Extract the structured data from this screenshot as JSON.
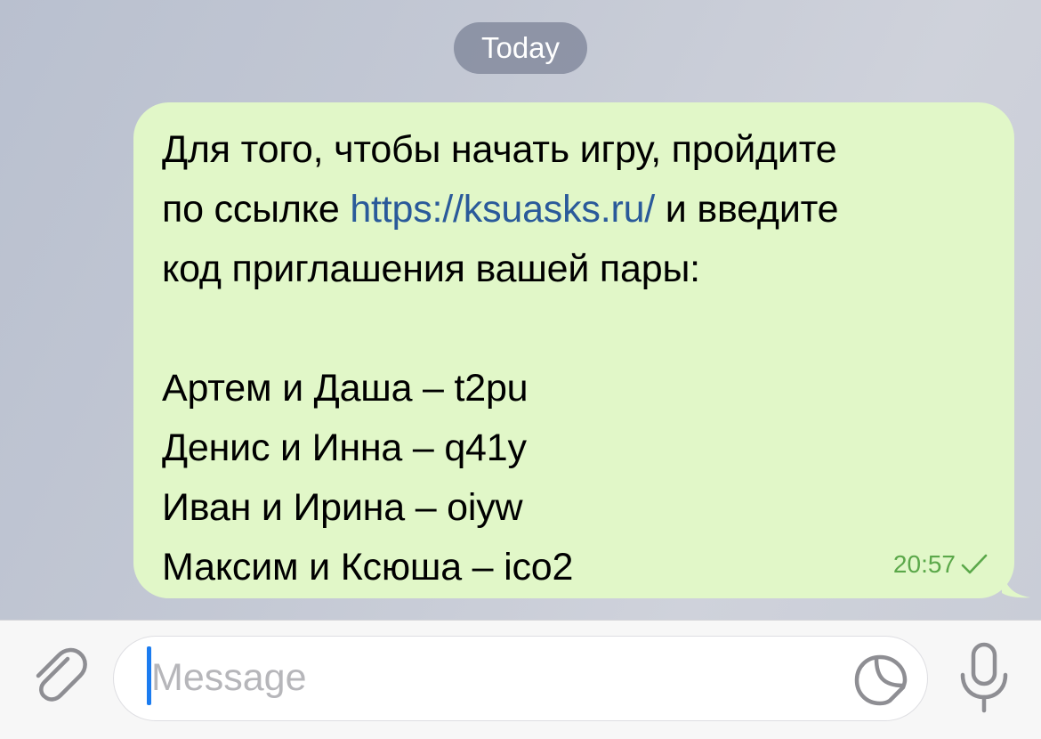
{
  "chat": {
    "date_label": "Today",
    "message": {
      "line1": "Для того, чтобы начать игру, пройдите",
      "line2_prefix": "по ссылке ",
      "line2_link": "https://ksuasks.ru/",
      "line2_suffix": " и введите",
      "line3": "код приглашения вашей пары:",
      "pairs": [
        "Артем и Даша – t2pu",
        "Денис и Инна – q41y",
        "Иван и Ирина – oiyw",
        "Максим и Ксюша – ico2"
      ],
      "time": "20:57",
      "status_icon": "check-icon",
      "colors": {
        "bubble": "#e1f7c8",
        "link": "#2a5a9a",
        "meta": "#5ba84a"
      }
    }
  },
  "composer": {
    "placeholder": "Message",
    "attach_icon": "paperclip-icon",
    "sticker_icon": "sticker-icon",
    "mic_icon": "microphone-icon",
    "accent": "#1b7cf0"
  }
}
